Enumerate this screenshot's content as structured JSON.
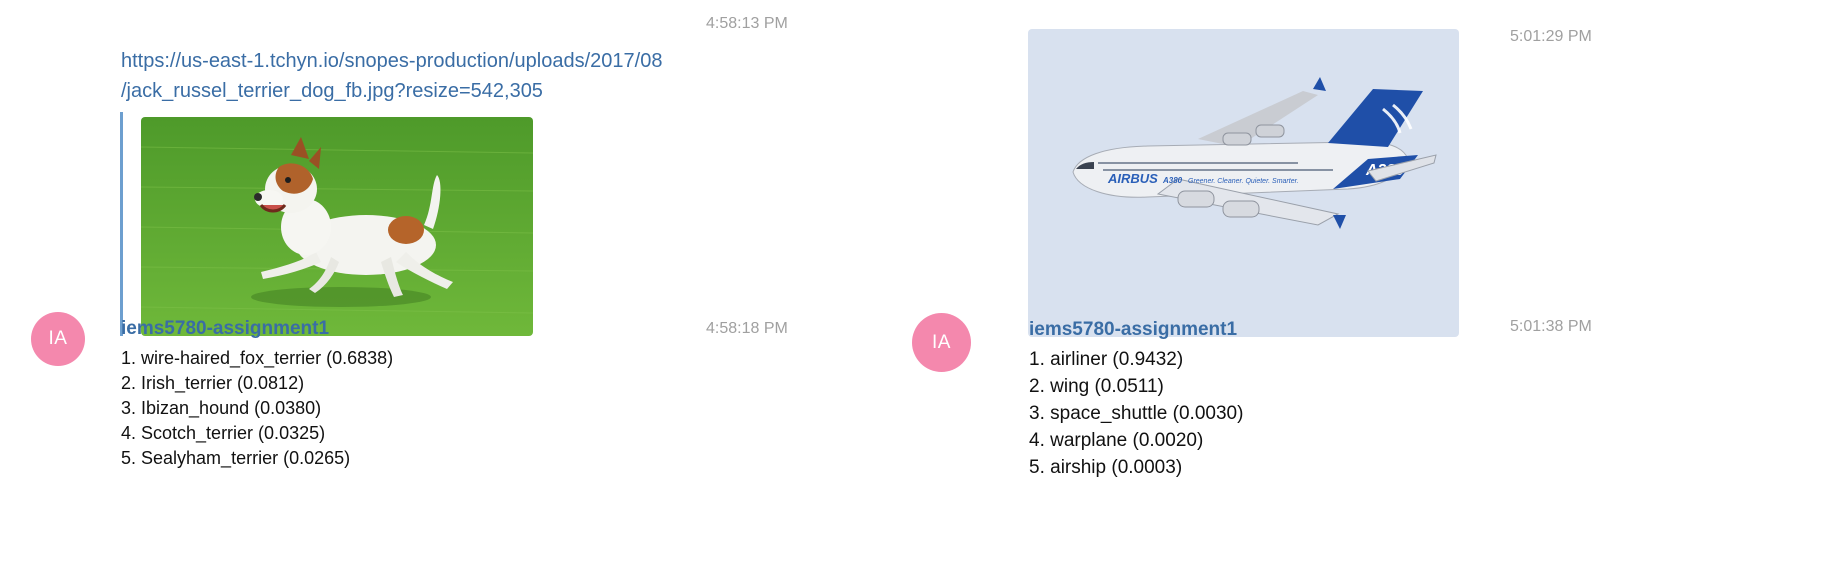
{
  "left_message": {
    "image_post": {
      "time": "4:58:13 PM",
      "link_lines": [
        "https://us-east-1.tchyn.io/snopes-production/uploads/2017/08",
        "/jack_russel_terrier_dog_fb.jpg?resize=542,305"
      ]
    },
    "reply": {
      "avatar_initials": "IA",
      "sender": "iems5780-assignment1",
      "time": "4:58:18 PM",
      "results": [
        "1. wire-haired_fox_terrier (0.6838)",
        "2. Irish_terrier (0.0812)",
        "3. Ibizan_hound (0.0380)",
        "4. Scotch_terrier (0.0325)",
        "5. Sealyham_terrier (0.0265)"
      ]
    }
  },
  "right_message": {
    "image_post": {
      "time": "5:01:29 PM",
      "aircraft_branding": "AIRBUS",
      "aircraft_model": "A380",
      "aircraft_slogan": "Greener. Cleaner. Quieter. Smarter."
    },
    "reply": {
      "avatar_initials": "IA",
      "sender": "iems5780-assignment1",
      "time": "5:01:38 PM",
      "results": [
        "1. airliner (0.9432)",
        "2. wing (0.0511)",
        "3. space_shuttle (0.0030)",
        "4. warplane (0.0020)",
        "5. airship (0.0003)"
      ]
    }
  },
  "colors": {
    "link": "#3a6da5",
    "timestamp": "#a0a0a0",
    "avatar_bg": "#f488ad",
    "preview_bar": "#6d9fcf",
    "grass": "#5fa832",
    "sky": "#d8e1ef"
  }
}
